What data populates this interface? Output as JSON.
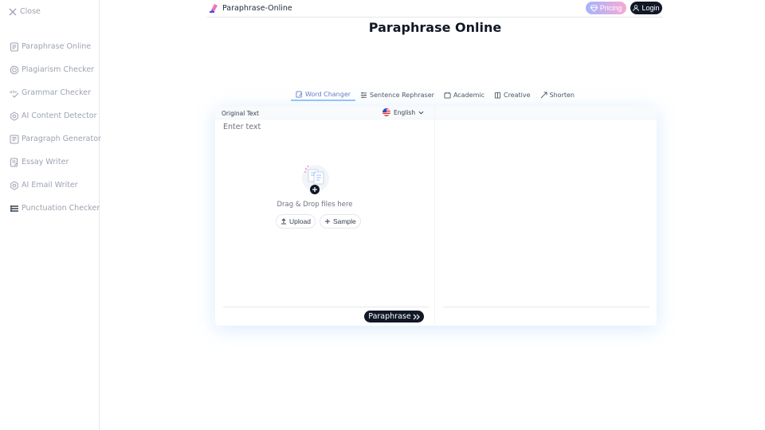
{
  "sidebar": {
    "close_label": "Close",
    "items": [
      {
        "label": "Paraphrase Online",
        "icon": "document-icon"
      },
      {
        "label": "Plagiarism Checker",
        "icon": "plagiarism-icon"
      },
      {
        "label": "Grammar Checker",
        "icon": "spellcheck-icon"
      },
      {
        "label": "AI Content Detector",
        "icon": "ai-detector-icon"
      },
      {
        "label": "Paragraph Generator",
        "icon": "paragraph-icon"
      },
      {
        "label": "Essay Writer",
        "icon": "essay-icon"
      },
      {
        "label": "AI Email Writer",
        "icon": "email-writer-icon"
      },
      {
        "label": "Punctuation Checker",
        "icon": "punctuation-icon"
      }
    ]
  },
  "header": {
    "brand": "Paraphrase-Online",
    "pricing_label": "Pricing",
    "login_label": "Login"
  },
  "page_title": "Paraphrase Online",
  "tabs": [
    {
      "label": "Word Changer",
      "active": true
    },
    {
      "label": "Sentence Rephraser",
      "active": false
    },
    {
      "label": "Academic",
      "active": false
    },
    {
      "label": "Creative",
      "active": false
    },
    {
      "label": "Shorten",
      "active": false
    }
  ],
  "editor": {
    "original_label": "Original Text",
    "language": "English",
    "placeholder": "Enter text",
    "drop_text": "Drag & Drop files here",
    "upload_label": "Upload",
    "sample_label": "Sample",
    "paraphrase_label": "Paraphrase"
  },
  "colors": {
    "accent": "#111827",
    "tab_active": "#6b7cc9",
    "pricing_from": "#a5b4fc",
    "pricing_to": "#f9a8d4"
  }
}
